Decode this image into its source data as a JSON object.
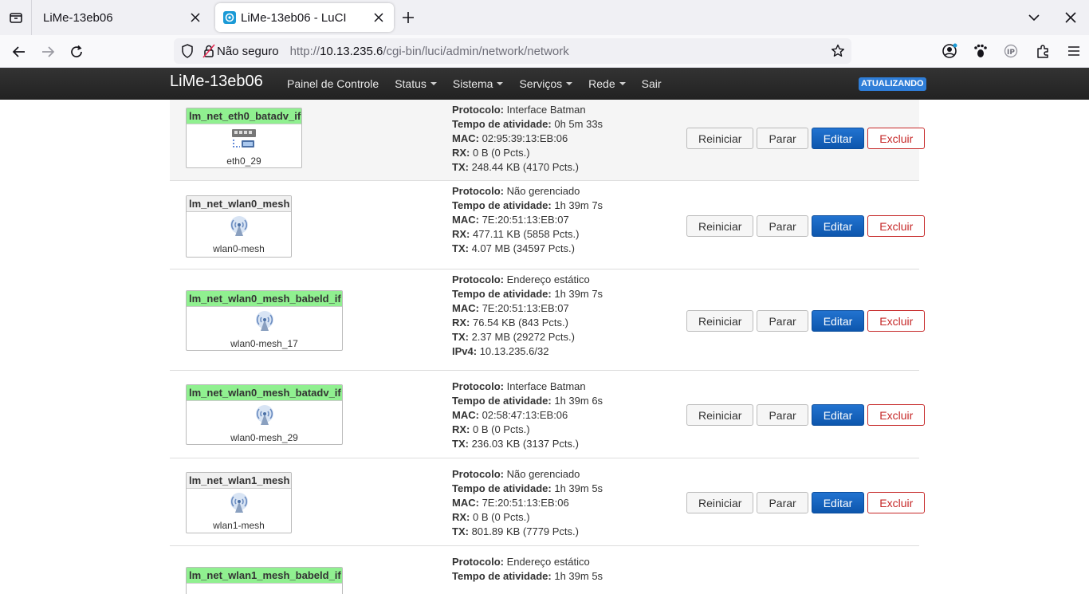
{
  "browser": {
    "tabs": [
      {
        "title": "LiMe-13eb06",
        "active": false
      },
      {
        "title": "LiMe-13eb06 - LuCI",
        "active": true
      }
    ],
    "security_label": "Não seguro",
    "url_prefix": "http://",
    "url_host": "10.13.235.6",
    "url_path": "/cgi-bin/luci/admin/network/network"
  },
  "header": {
    "brand": "LiMe-13eb06",
    "menu": [
      {
        "label": "Painel de Controle",
        "dropdown": false
      },
      {
        "label": "Status",
        "dropdown": true
      },
      {
        "label": "Sistema",
        "dropdown": true
      },
      {
        "label": "Serviços",
        "dropdown": true
      },
      {
        "label": "Rede",
        "dropdown": true
      },
      {
        "label": "Sair",
        "dropdown": false
      }
    ],
    "badge": "ATUALIZANDO"
  },
  "labels": {
    "protocol": "Protocolo:",
    "uptime": "Tempo de atividade:",
    "mac": "MAC:",
    "rx": "RX:",
    "tx": "TX:",
    "ipv4": "IPv4:"
  },
  "buttons": {
    "restart": "Reiniciar",
    "stop": "Parar",
    "edit": "Editar",
    "delete": "Excluir"
  },
  "interfaces": [
    {
      "name": "lm_net_eth0_batadv_if",
      "device": "eth0_29",
      "protocol": "Interface Batman",
      "uptime": "0h 5m 33s",
      "mac": "02:95:39:13:EB:06",
      "rx": "0 B (0 Pcts.)",
      "tx": "248.44 KB (4170 Pcts.)",
      "ipv4": ""
    },
    {
      "name": "lm_net_wlan0_mesh",
      "device": "wlan0-mesh",
      "protocol": "Não gerenciado",
      "uptime": "1h 39m 7s",
      "mac": "7E:20:51:13:EB:07",
      "rx": "477.11 KB (5858 Pcts.)",
      "tx": "4.07 MB (34597 Pcts.)",
      "ipv4": ""
    },
    {
      "name": "lm_net_wlan0_mesh_babeld_if",
      "device": "wlan0-mesh_17",
      "protocol": "Endereço estático",
      "uptime": "1h 39m 7s",
      "mac": "7E:20:51:13:EB:07",
      "rx": "76.54 KB (843 Pcts.)",
      "tx": "2.37 MB (29272 Pcts.)",
      "ipv4": "10.13.235.6/32"
    },
    {
      "name": "lm_net_wlan0_mesh_batadv_if",
      "device": "wlan0-mesh_29",
      "protocol": "Interface Batman",
      "uptime": "1h 39m 6s",
      "mac": "02:58:47:13:EB:06",
      "rx": "0 B (0 Pcts.)",
      "tx": "236.03 KB (3137 Pcts.)",
      "ipv4": ""
    },
    {
      "name": "lm_net_wlan1_mesh",
      "device": "wlan1-mesh",
      "protocol": "Não gerenciado",
      "uptime": "1h 39m 5s",
      "mac": "7E:20:51:13:EB:06",
      "rx": "0 B (0 Pcts.)",
      "tx": "801.89 KB (7779 Pcts.)",
      "ipv4": ""
    },
    {
      "name": "lm_net_wlan1_mesh_babeld_if",
      "device": "",
      "protocol": "Endereço estático",
      "uptime": "1h 39m 5s",
      "mac": "",
      "rx": "",
      "tx": "",
      "ipv4": ""
    }
  ]
}
